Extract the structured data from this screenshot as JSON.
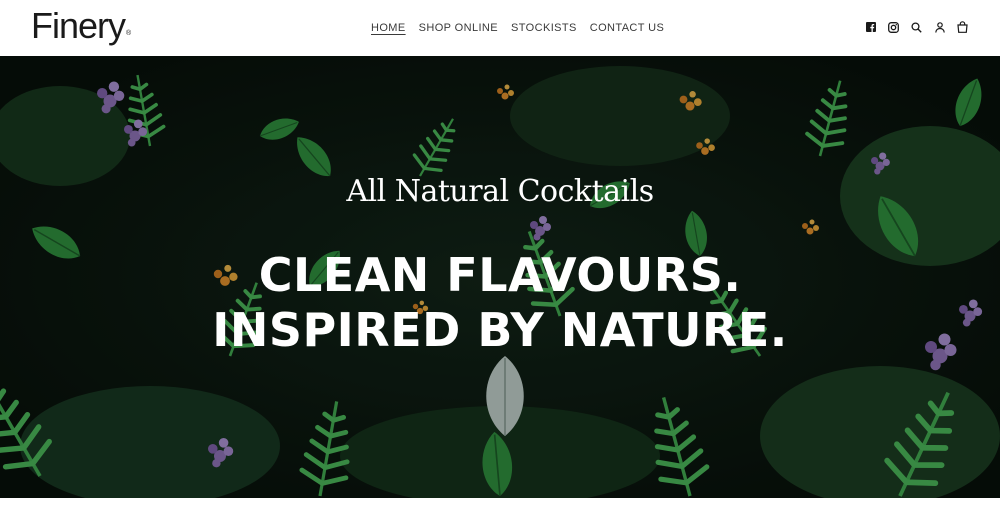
{
  "brand": {
    "name": "Finery",
    "mark": "®"
  },
  "nav": {
    "items": [
      {
        "label": "HOME",
        "active": true
      },
      {
        "label": "SHOP ONLINE",
        "active": false
      },
      {
        "label": "STOCKISTS",
        "active": false
      },
      {
        "label": "CONTACT US",
        "active": false
      }
    ]
  },
  "header_icons": [
    "facebook-icon",
    "instagram-icon",
    "search-icon",
    "account-icon",
    "cart-icon"
  ],
  "hero": {
    "subtitle": "All Natural Cocktails",
    "headline_line1": "CLEAN FLAVOURS.",
    "headline_line2": "INSPIRED BY NATURE."
  },
  "colors": {
    "text_dark": "#1a1a1a",
    "hero_text": "#ffffff",
    "foliage_dark": "#0d1a10",
    "foliage_green": "#3fa34d",
    "flower_purple": "#8a6fb0",
    "flower_orange": "#d98b2b"
  }
}
